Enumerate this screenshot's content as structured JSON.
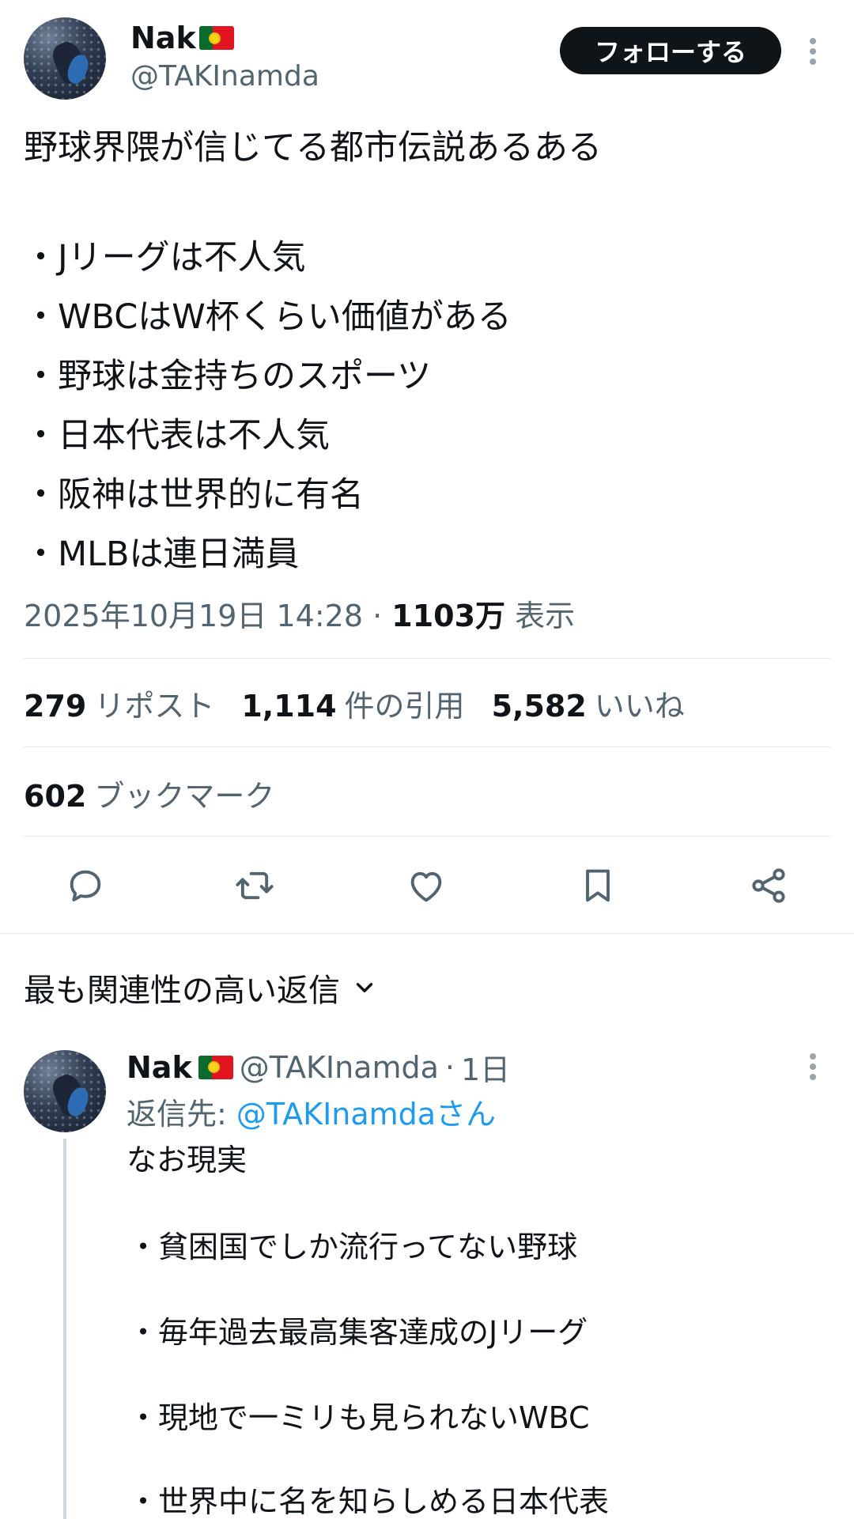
{
  "tweet": {
    "display_name": "Nak",
    "handle": "@TAKInamda",
    "follow_label": "フォローする",
    "title_line": "野球界隈が信じてる都市伝説あるある",
    "bullets": [
      "・Jリーグは不人気",
      "・WBCはW杯くらい価値がある",
      "・野球は金持ちのスポーツ",
      "・日本代表は不人気",
      "・阪神は世界的に有名",
      "・MLBは連日満員"
    ],
    "timestamp": "2025年10月19日 14:28",
    "separator": "·",
    "views_count": "1103万",
    "views_label": "表示"
  },
  "stats": {
    "reposts_count": "279",
    "reposts_label": "リポスト",
    "quotes_count": "1,114",
    "quotes_label": "件の引用",
    "likes_count": "5,582",
    "likes_label": "いいね",
    "bookmarks_count": "602",
    "bookmarks_label": "ブックマーク"
  },
  "actions": {
    "icons": [
      "reply-icon",
      "repost-icon",
      "like-icon",
      "bookmark-icon",
      "share-icon"
    ],
    "icon_color": "#536471"
  },
  "sort": {
    "label": "最も関連性の高い返信"
  },
  "reply": {
    "display_name": "Nak",
    "handle": "@TAKInamda",
    "separator": "·",
    "age": "1日",
    "reply_to_prefix": "返信先: ",
    "reply_to_handle": "@TAKInamdaさん",
    "first_line": "なお現実",
    "bullets": [
      "・貧困国でしか流行ってない野球",
      "・毎年過去最高集客達成のJリーグ",
      "・現地で一ミリも見られないWBC",
      "・世界中に名を知らしめる日本代表"
    ]
  },
  "colors": {
    "text": "#0f1419",
    "secondary": "#536471",
    "link": "#1d9bf0",
    "button_bg": "#0f1419",
    "divider": "#e6eaed"
  }
}
